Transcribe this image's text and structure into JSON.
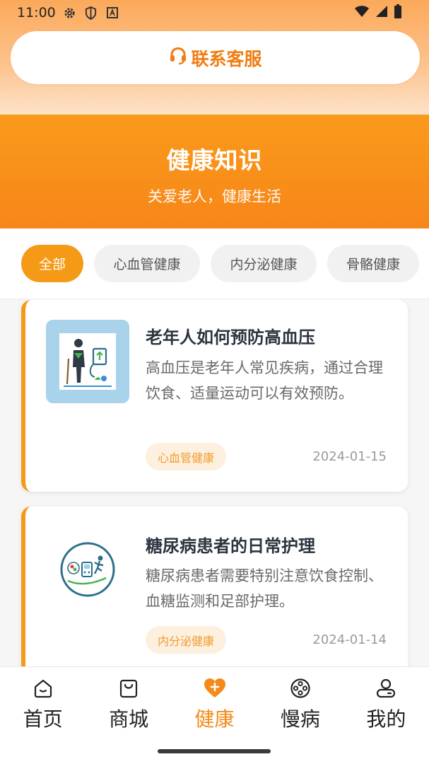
{
  "status_bar": {
    "time": "11:00",
    "left_icons": [
      "gear-icon",
      "shield-icon",
      "text-notification-icon"
    ],
    "right_icons": [
      "wifi-icon",
      "signal-icon",
      "battery-icon"
    ]
  },
  "support": {
    "label": "联系客服",
    "icon": "headset-icon"
  },
  "banner": {
    "title": "健康知识",
    "subtitle": "关爱老人，健康生活"
  },
  "categories": {
    "items": [
      {
        "label": "全部",
        "active": true
      },
      {
        "label": "心血管健康",
        "active": false
      },
      {
        "label": "内分泌健康",
        "active": false
      },
      {
        "label": "骨骼健康",
        "active": false
      }
    ]
  },
  "articles": [
    {
      "title": "老年人如何预防高血压",
      "desc": "高血压是老年人常见疾病，通过合理饮食、适量运动可以有效预防。",
      "tag": "心血管健康",
      "date": "2024-01-15"
    },
    {
      "title": "糖尿病患者的日常护理",
      "desc": "糖尿病患者需要特别注意饮食控制、血糖监测和足部护理。",
      "tag": "内分泌健康",
      "date": "2024-01-14"
    }
  ],
  "nav": {
    "items": [
      {
        "label": "首页",
        "icon": "home-icon",
        "active": false
      },
      {
        "label": "商城",
        "icon": "shopping-bag-icon",
        "active": false
      },
      {
        "label": "健康",
        "icon": "heart-plus-icon",
        "active": true
      },
      {
        "label": "慢病",
        "icon": "film-reel-icon",
        "active": false
      },
      {
        "label": "我的",
        "icon": "user-icon",
        "active": false
      }
    ]
  },
  "colors": {
    "accent": "#f59a16",
    "banner": "#f7861a",
    "tag_bg": "#fdf0de"
  }
}
